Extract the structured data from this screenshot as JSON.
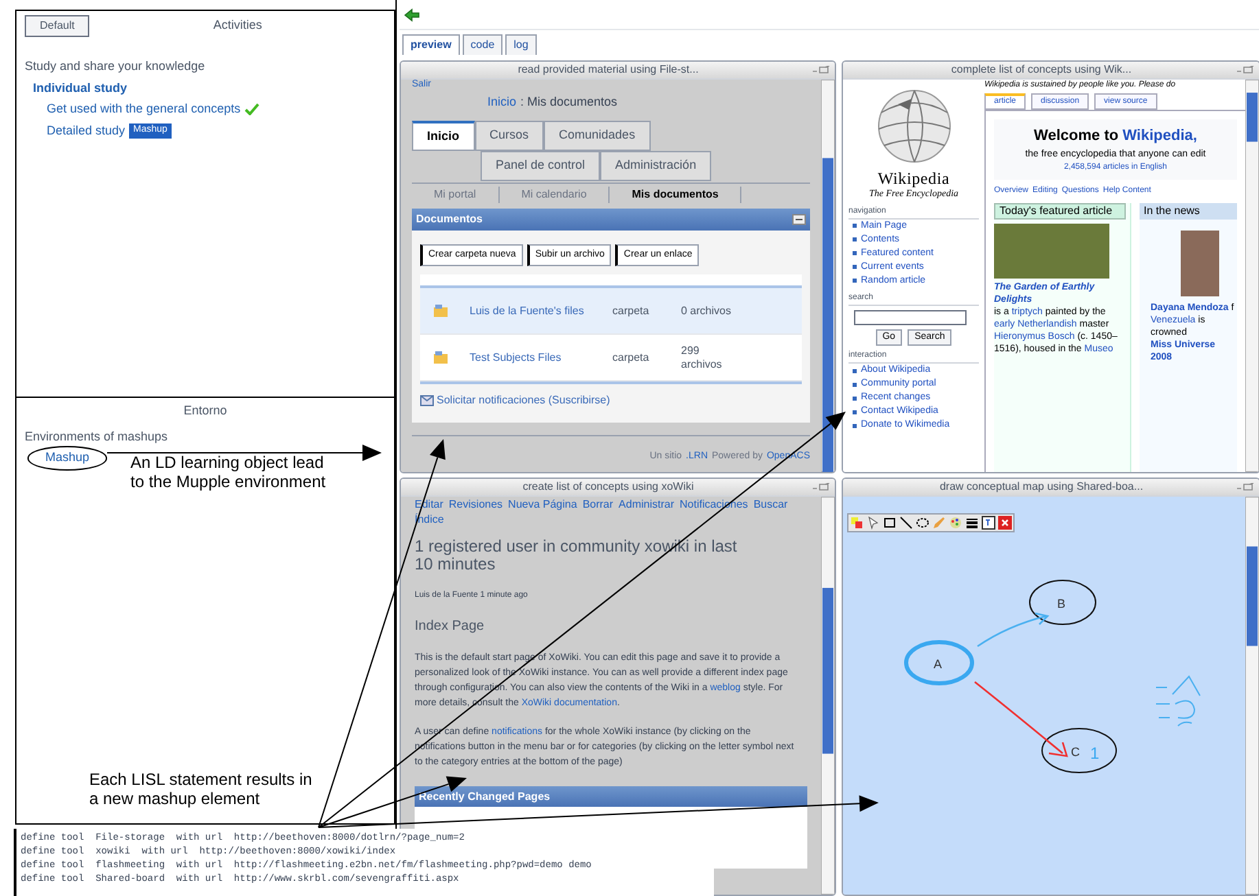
{
  "left": {
    "top_button": "Default",
    "activities_title": "Activities",
    "intro": "Study and share your knowledge",
    "tree": [
      {
        "label": "Individual study",
        "done": false,
        "children": [
          {
            "label": "Get used with the general concepts",
            "done": true
          },
          {
            "label": "Detailed study",
            "done": false,
            "badge": "Mashup"
          }
        ]
      }
    ],
    "environment_title": "Entorno",
    "environment_text": "Environments of mashups",
    "mashup_link": "Mashup"
  },
  "top_tabs": [
    {
      "label": "preview",
      "selected": true
    },
    {
      "label": "code",
      "selected": false
    },
    {
      "label": "log",
      "selected": false
    }
  ],
  "windows": [
    {
      "kind": "portal",
      "title": "read provided material using File-st...",
      "exit": "Salir",
      "breadcrumb_link": "Inicio",
      "breadcrumb_rest": ": Mis documentos",
      "tabs_row1": [
        {
          "label": "Inicio",
          "selected": true
        },
        {
          "label": "Cursos",
          "selected": false
        },
        {
          "label": "Comunidades",
          "selected": false
        }
      ],
      "tabs_row2": [
        {
          "label": "Panel de control",
          "selected": false
        },
        {
          "label": "Administración",
          "selected": false
        }
      ],
      "subnav": [
        {
          "label": "Mi portal",
          "selected": false
        },
        {
          "label": "Mi calendario",
          "selected": false
        },
        {
          "label": "Mis documentos",
          "selected": true
        }
      ],
      "panel_title": "Documentos",
      "buttons": [
        "Crear carpeta nueva",
        "Subir un archivo",
        "Crear un enlace"
      ],
      "rows": [
        {
          "name": "Luis de la Fuente's files",
          "type": "carpeta",
          "count": "0 archivos",
          "selected": true
        },
        {
          "name": "Test Subjects Files",
          "type": "carpeta",
          "count": "299 archivos",
          "selected": false
        }
      ],
      "subscribe": "Solicitar notificaciones (Suscribirse)",
      "footer": [
        {
          "text": "Un sitio",
          "link": false
        },
        {
          "text": ".LRN",
          "link": true
        },
        {
          "text": "Powered by",
          "link": false
        },
        {
          "text": "OpenACS",
          "link": true
        }
      ]
    },
    {
      "kind": "wiki",
      "title": "complete list of concepts using Wik...",
      "banner": "Wikipedia is sustained by people like you. Please do",
      "tabs": [
        {
          "label": "article",
          "selected": true
        },
        {
          "label": "discussion",
          "selected": false
        },
        {
          "label": "view source",
          "selected": false
        }
      ],
      "logo_name": "Wikipedia",
      "logo_tagline": "The Free Encyclopedia",
      "sections": [
        {
          "title": "navigation",
          "items": [
            "Main Page",
            "Contents",
            "Featured content",
            "Current events",
            "Random article"
          ]
        },
        {
          "title": "search"
        },
        {
          "title": "interaction",
          "items": [
            "About Wikipedia",
            "Community portal",
            "Recent changes",
            "Contact Wikipedia",
            "Donate to Wikimedia"
          ]
        }
      ],
      "search_buttons": [
        "Go",
        "Search"
      ],
      "welcome": "Welcome to",
      "welcome_link": "Wikipedia,",
      "subtitle": "the free encyclopedia that anyone can edit",
      "count": "2,458,594 articles in English",
      "links": [
        "Overview",
        "Editing",
        "Questions",
        "Help Content"
      ],
      "featured_title": "Today's featured article",
      "featured_text": [
        {
          "text": "The Garden of Earthly Delights",
          "link": true,
          "bold": true
        },
        {
          "text": " is a ",
          "link": false,
          "bold": false
        },
        {
          "text": "triptych",
          "link": true,
          "bold": false
        },
        {
          "text": " painted by the ",
          "link": false,
          "bold": false
        },
        {
          "text": "early Netherlandish",
          "link": true,
          "bold": false
        },
        {
          "text": " master ",
          "link": false,
          "bold": false
        },
        {
          "text": "Hieronymus Bosch",
          "link": true,
          "bold": false
        },
        {
          "text": " (c. 1450–1516), housed in the ",
          "link": false,
          "bold": false
        },
        {
          "text": "Museo",
          "link": true,
          "bold": false
        }
      ],
      "news_title": "In the news",
      "news_text": [
        {
          "text": "Dayana Mendoza",
          "link": true,
          "bold": true
        },
        {
          "text": " f ",
          "link": false,
          "bold": false
        },
        {
          "text": "Venezuela",
          "link": true,
          "bold": false
        },
        {
          "text": " is crowned ",
          "link": false,
          "bold": false
        },
        {
          "text": "Miss Universe 2008",
          "link": true,
          "bold": true
        }
      ]
    },
    {
      "kind": "xowiki",
      "title": "create list of concepts using xoWiki",
      "actions": [
        "Editar",
        "Revisiones",
        "Nueva Página",
        "Borrar",
        "Administrar",
        "Notificaciones",
        "Buscar",
        "Índice"
      ],
      "heading": "1 registered user in community xowiki in last 10 minutes",
      "recent_user": "Luis de la Fuente 1 minute ago",
      "page_title": "Index Page",
      "paragraphs": [
        [
          {
            "text": "This is the default start page of XoWiki. You can edit this page and save it to provide a personalized look of the XoWiki instance. You can as well provide a different index page through configuration. You can also view the contents of the Wiki in a ",
            "link": false
          },
          {
            "text": "weblog",
            "link": true
          },
          {
            "text": " style. For more details, consult the ",
            "link": false
          },
          {
            "text": "XoWiki documentation",
            "link": true
          },
          {
            "text": ".",
            "link": false
          }
        ],
        [
          {
            "text": "A user can define ",
            "link": false
          },
          {
            "text": "notifications",
            "link": true
          },
          {
            "text": " for the whole XoWiki instance (by clicking on the notifications button in the menu bar or for categories (by clicking on the letter symbol next to the category entries at the bottom of the page)",
            "link": false
          }
        ]
      ],
      "box_title": "Recently Changed Pages"
    },
    {
      "kind": "whiteboard",
      "title": "draw conceptual map using Shared-boa...",
      "nodes": [
        "A",
        "B",
        "C"
      ],
      "note": "1"
    }
  ],
  "code_lines": [
    "define tool  File-storage  with url  http://beethoven:8000/dotlrn/?page_num=2",
    "define tool  xowiki  with url  http://beethoven:8000/xowiki/index",
    "define tool  flashmeeting  with url  http://flashmeeting.e2bn.net/fm/flashmeeting.php?pwd=demo demo",
    "define tool  Shared-board  with url  http://www.skrbl.com/sevengraffiti.aspx"
  ],
  "annotations": [
    "An LD learning object lead to the Mupple environment",
    "Each LISL statement results in a new mashup element"
  ]
}
